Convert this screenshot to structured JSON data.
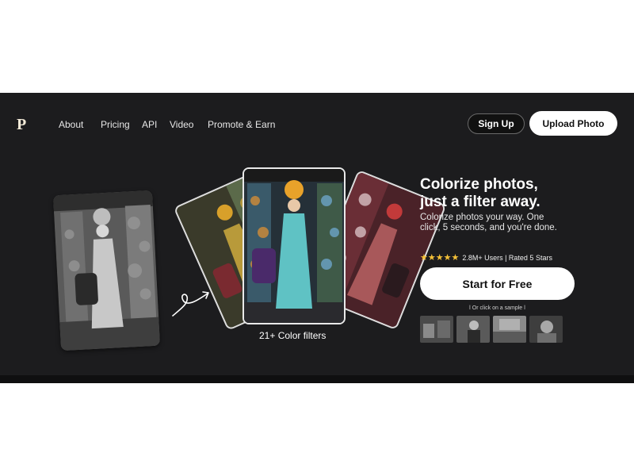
{
  "brand": {
    "logo_letter": "P"
  },
  "nav": {
    "items": [
      {
        "label": "About"
      },
      {
        "label": "Pricing"
      },
      {
        "label": "API"
      },
      {
        "label": "Video"
      },
      {
        "label": "Promote & Earn"
      }
    ]
  },
  "header": {
    "signup_label": "Sign Up",
    "upload_label": "Upload Photo"
  },
  "hero": {
    "headline_line1": "Colorize photos,",
    "headline_line2": "just a filter away.",
    "subtitle": "Colorize photos your way. One click, 5 seconds, and you're done.",
    "stars": "★★★★★",
    "rating_text": "2.8M+ Users | Rated 5 Stars",
    "rating_value": 5,
    "cta_label": "Start for Free",
    "sample_hint": "ǀ Or click on a sample ǀ",
    "filters_caption": "21+ Color filters"
  },
  "samples": [
    {
      "name": "sample-photo-1"
    },
    {
      "name": "sample-photo-2"
    },
    {
      "name": "sample-photo-3"
    },
    {
      "name": "sample-photo-4"
    }
  ],
  "colors": {
    "background": "#1c1c1e",
    "accent_star": "#f6c238",
    "button_bg": "#ffffff"
  }
}
